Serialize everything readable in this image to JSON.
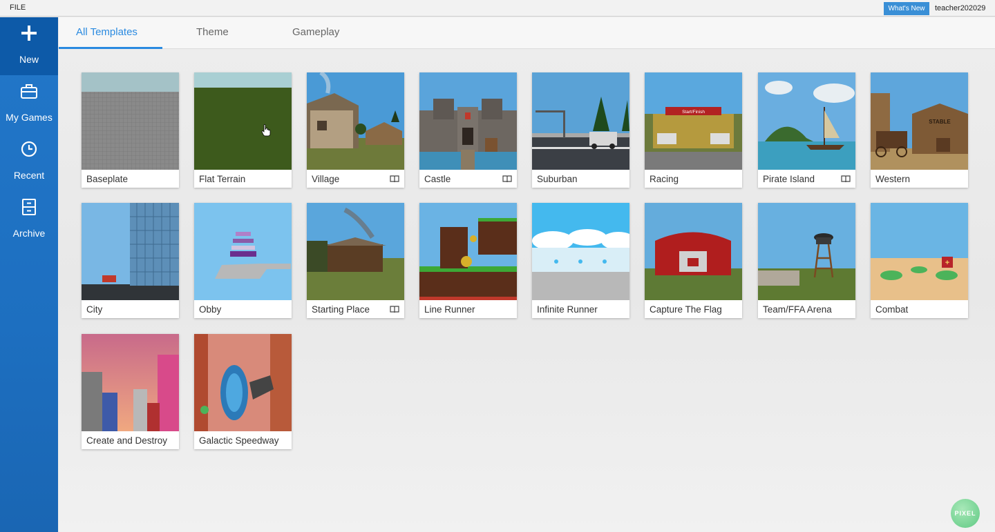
{
  "menu": {
    "file": "FILE"
  },
  "top_right": {
    "whats_new": "What's New",
    "username": "teacher202029"
  },
  "sidebar": {
    "items": [
      {
        "label": "New",
        "icon": "plus-icon",
        "active": true
      },
      {
        "label": "My Games",
        "icon": "briefcase-icon",
        "active": false
      },
      {
        "label": "Recent",
        "icon": "clock-icon",
        "active": false
      },
      {
        "label": "Archive",
        "icon": "archive-icon",
        "active": false
      }
    ]
  },
  "tabs": [
    {
      "label": "All Templates",
      "active": true
    },
    {
      "label": "Theme",
      "active": false
    },
    {
      "label": "Gameplay",
      "active": false
    }
  ],
  "templates": [
    {
      "label": "Baseplate",
      "tutorial": false
    },
    {
      "label": "Flat Terrain",
      "tutorial": false
    },
    {
      "label": "Village",
      "tutorial": true
    },
    {
      "label": "Castle",
      "tutorial": true
    },
    {
      "label": "Suburban",
      "tutorial": false
    },
    {
      "label": "Racing",
      "tutorial": false
    },
    {
      "label": "Pirate Island",
      "tutorial": true
    },
    {
      "label": "Western",
      "tutorial": false
    },
    {
      "label": "City",
      "tutorial": false
    },
    {
      "label": "Obby",
      "tutorial": false
    },
    {
      "label": "Starting Place",
      "tutorial": true
    },
    {
      "label": "Line Runner",
      "tutorial": false
    },
    {
      "label": "Infinite Runner",
      "tutorial": false
    },
    {
      "label": "Capture The Flag",
      "tutorial": false
    },
    {
      "label": "Team/FFA Arena",
      "tutorial": false
    },
    {
      "label": "Combat",
      "tutorial": false
    },
    {
      "label": "Create and Destroy",
      "tutorial": false
    },
    {
      "label": "Galactic Speedway",
      "tutorial": false
    }
  ],
  "thumbnails": {
    "racing_banner": "Start/Finish",
    "western_sign": "STABLE"
  },
  "watermark": "PIXEL",
  "colors": {
    "accent": "#2a8ae0",
    "sidebar": "#1d6fc0",
    "sidebar_active": "#0d5aa8",
    "whats_new": "#3a8fd6"
  }
}
